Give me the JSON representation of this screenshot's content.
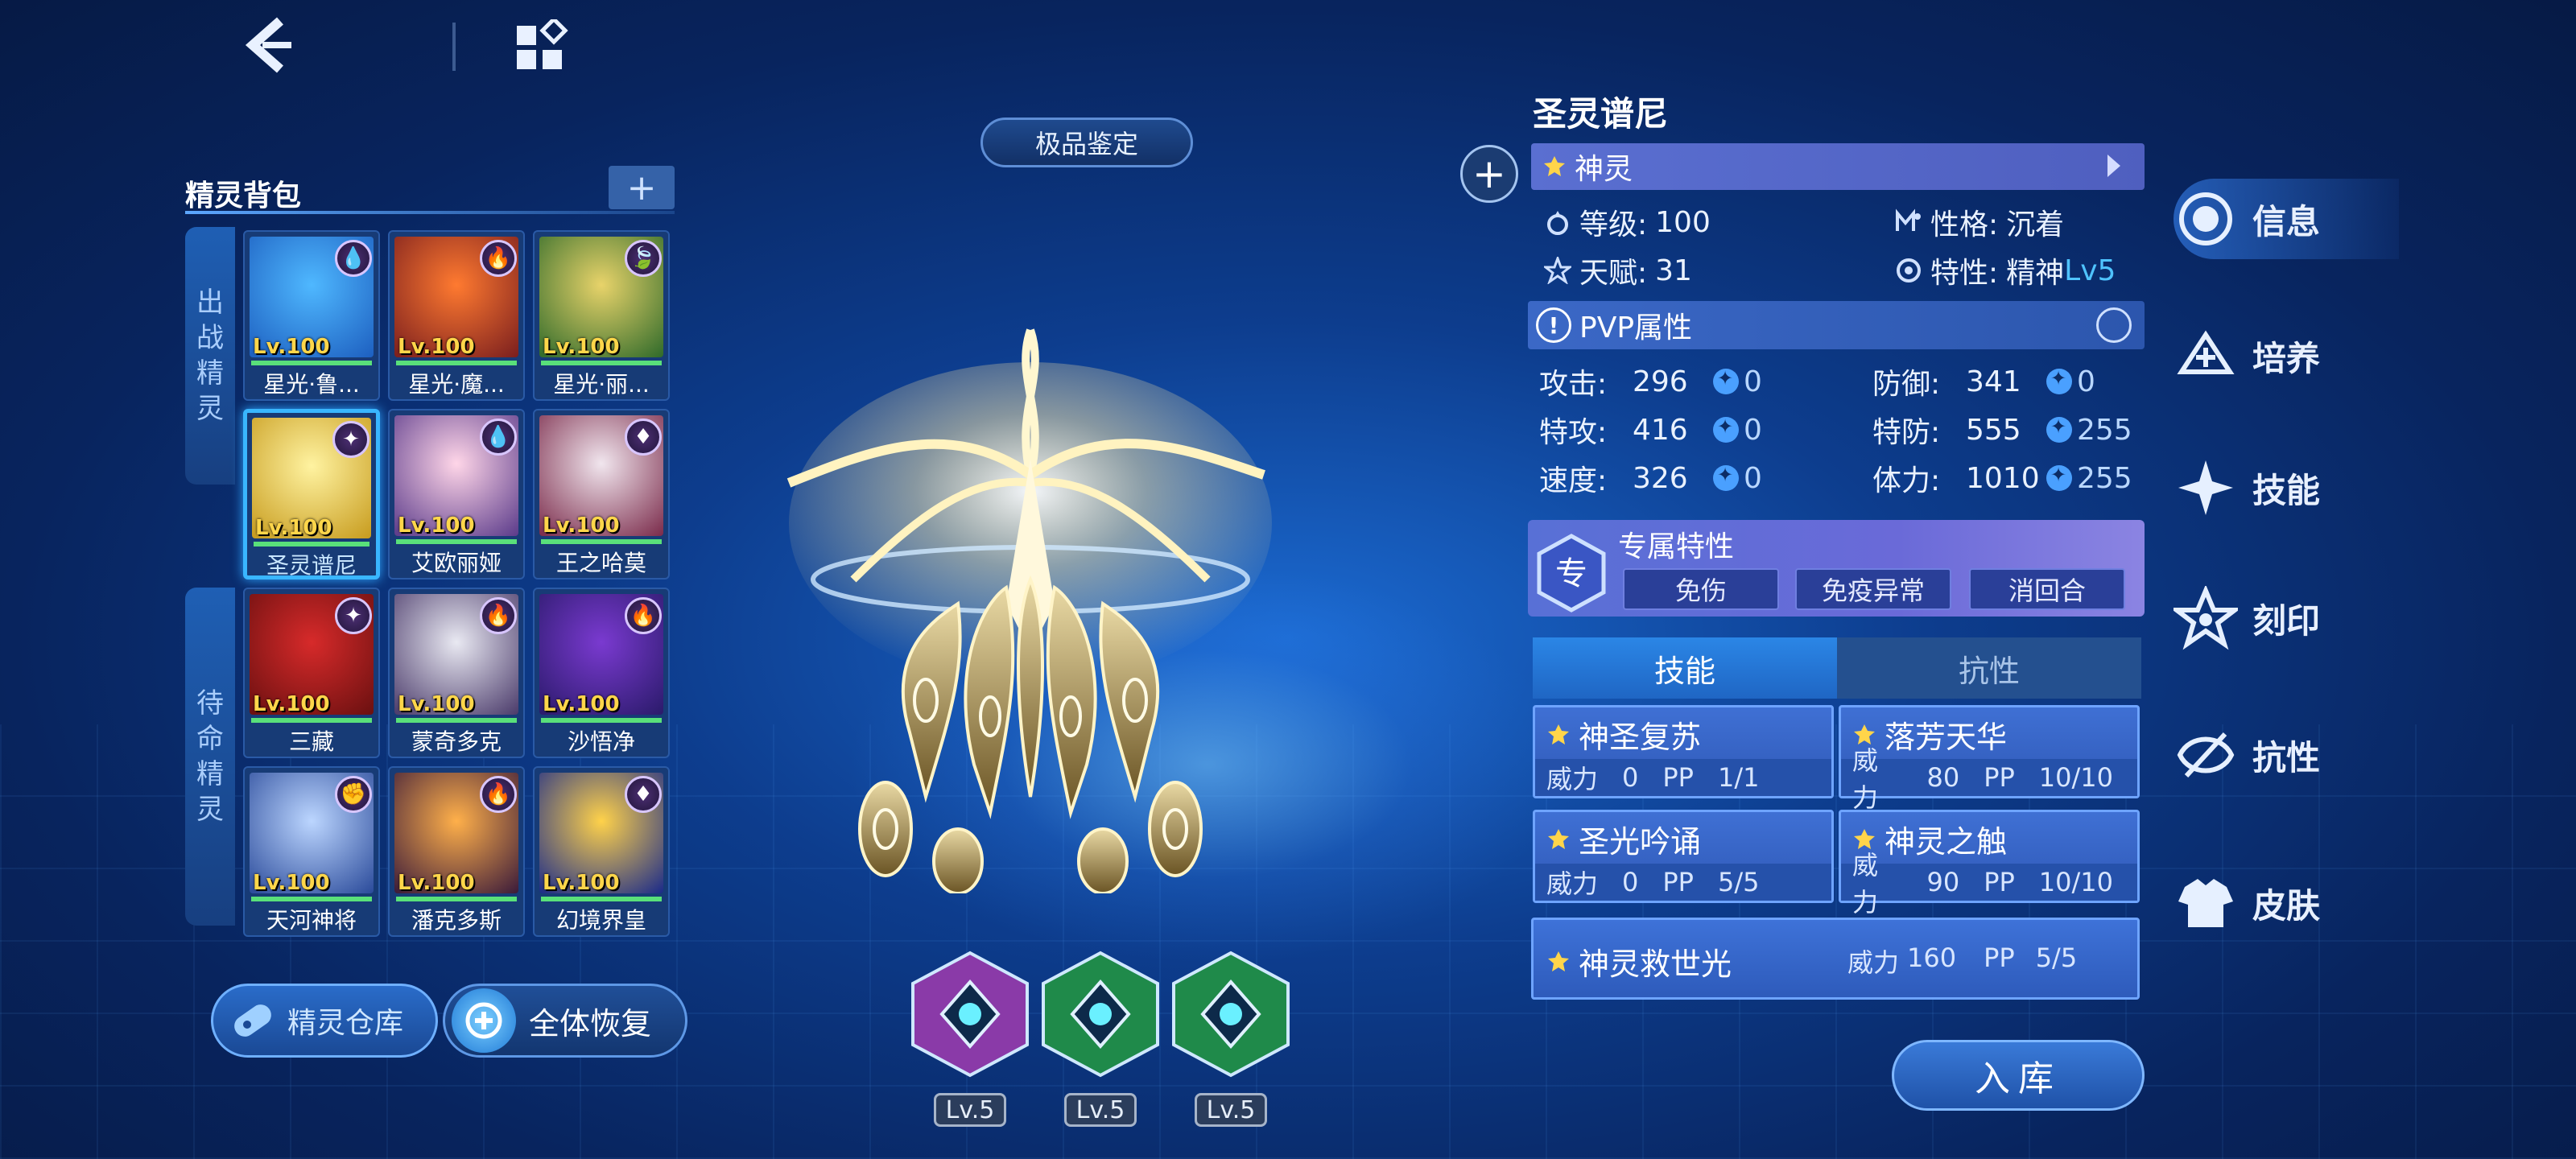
{
  "nav": {
    "back_icon": "back-arrow-icon",
    "menu_icon": "grid-menu-icon"
  },
  "bag": {
    "title": "精灵背包",
    "add_label": "+",
    "battle_tab": [
      "出",
      "战",
      "精",
      "灵"
    ],
    "standby_tab": [
      "待",
      "命",
      "精",
      "灵"
    ],
    "pets": [
      {
        "name": "星光·鲁...",
        "level": "Lv.100",
        "element": "water-icon",
        "selected": false,
        "colors": [
          "#4fb8ff",
          "#1d5fc0"
        ]
      },
      {
        "name": "星光·魔...",
        "level": "Lv.100",
        "element": "fire-icon",
        "selected": false,
        "colors": [
          "#ff7a30",
          "#7a1e1e"
        ]
      },
      {
        "name": "星光·丽...",
        "level": "Lv.100",
        "element": "leaf-icon",
        "selected": false,
        "colors": [
          "#e8d36a",
          "#2f6a2a"
        ]
      },
      {
        "name": "圣灵谱尼",
        "level": "Lv.100",
        "element": "divine-icon",
        "selected": true,
        "colors": [
          "#fff3a1",
          "#c79b1d"
        ]
      },
      {
        "name": "艾欧丽娅",
        "level": "Lv.100",
        "element": "water-icon",
        "selected": false,
        "colors": [
          "#ffd6e8",
          "#5a3a8a"
        ]
      },
      {
        "name": "王之哈莫",
        "level": "Lv.100",
        "element": "dragon-icon",
        "selected": false,
        "colors": [
          "#f1e6ee",
          "#7a2a4a"
        ]
      },
      {
        "name": "三藏",
        "level": "Lv.100",
        "element": "divine-icon",
        "selected": false,
        "colors": [
          "#d72a2a",
          "#6a1010"
        ]
      },
      {
        "name": "蒙奇多克",
        "level": "Lv.100",
        "element": "fire-icon",
        "selected": false,
        "colors": [
          "#e9e9f2",
          "#4a3a6a"
        ]
      },
      {
        "name": "沙悟净",
        "level": "Lv.100",
        "element": "fire-icon",
        "selected": false,
        "colors": [
          "#7a3ad0",
          "#2a1a6a"
        ]
      },
      {
        "name": "天河神将",
        "level": "Lv.100",
        "element": "fight-icon",
        "selected": false,
        "colors": [
          "#bcd6ff",
          "#2a4a9a"
        ]
      },
      {
        "name": "潘克多斯",
        "level": "Lv.100",
        "element": "fire-icon",
        "selected": false,
        "colors": [
          "#ffb04a",
          "#3a1a3a"
        ]
      },
      {
        "name": "幻境界皇",
        "level": "Lv.100",
        "element": "dragon-icon",
        "selected": false,
        "colors": [
          "#ffd24a",
          "#1a2a8a"
        ]
      }
    ],
    "hp_fraction": 1.0,
    "storage_label": "精灵仓库",
    "heal_label": "全体恢复"
  },
  "center": {
    "appraise_label": "极品鉴定",
    "runes": [
      {
        "level": "Lv.5",
        "color": "#8a3aa8"
      },
      {
        "level": "Lv.5",
        "color": "#1f8a4a"
      },
      {
        "level": "Lv.5",
        "color": "#1f8a4a"
      }
    ]
  },
  "info": {
    "name": "圣灵谱尼",
    "type": "神灵",
    "level_label": "等级:",
    "level_value": "100",
    "nature_label": "性格:",
    "nature_value": "沉着",
    "talent_label": "天赋:",
    "talent_value": "31",
    "trait_label": "特性:",
    "trait_value": "精神",
    "trait_level": "Lv5",
    "pvp_title": "PVP属性",
    "stats": [
      {
        "label": "攻击:",
        "value": "296",
        "ev": "0"
      },
      {
        "label": "防御:",
        "value": "341",
        "ev": "0"
      },
      {
        "label": "特攻:",
        "value": "416",
        "ev": "0"
      },
      {
        "label": "特防:",
        "value": "555",
        "ev": "255"
      },
      {
        "label": "速度:",
        "value": "326",
        "ev": "0"
      },
      {
        "label": "体力:",
        "value": "1010",
        "ev": "255"
      }
    ],
    "exclusive_title": "专属特性",
    "exclusive_icon": "专",
    "exclusive_traits": [
      "免伤",
      "免疫异常",
      "消回合"
    ],
    "tabs": {
      "skills": "技能",
      "resist": "抗性"
    },
    "skills": [
      {
        "name": "神圣复苏",
        "power_label": "威力",
        "power": "0",
        "pp_label": "PP",
        "pp": "1/1"
      },
      {
        "name": "落芳天华",
        "power_label": "威力",
        "power": "80",
        "pp_label": "PP",
        "pp": "10/10"
      },
      {
        "name": "圣光吟诵",
        "power_label": "威力",
        "power": "0",
        "pp_label": "PP",
        "pp": "5/5"
      },
      {
        "name": "神灵之触",
        "power_label": "威力",
        "power": "90",
        "pp_label": "PP",
        "pp": "10/10"
      }
    ],
    "ultimate": {
      "name": "神灵救世光",
      "power_label": "威力",
      "power": "160",
      "pp_label": "PP",
      "pp": "5/5"
    },
    "store_label": "入库"
  },
  "menu": {
    "items": [
      {
        "label": "信息",
        "icon": "info-icon",
        "active": true
      },
      {
        "label": "培养",
        "icon": "train-icon",
        "active": false
      },
      {
        "label": "技能",
        "icon": "skill-icon",
        "active": false
      },
      {
        "label": "刻印",
        "icon": "mark-icon",
        "active": false
      },
      {
        "label": "抗性",
        "icon": "resist-icon",
        "active": false
      },
      {
        "label": "皮肤",
        "icon": "skin-icon",
        "active": false
      }
    ]
  }
}
